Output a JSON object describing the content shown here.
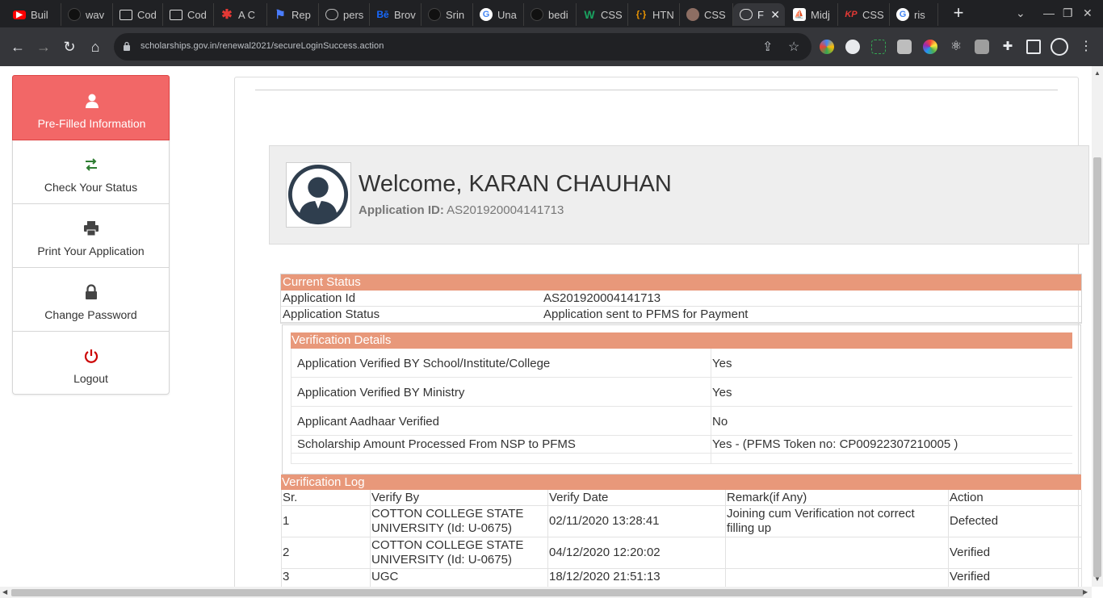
{
  "browser": {
    "tabs": [
      {
        "label": "Buil",
        "icon": "youtube-icon",
        "color": "#ff0000"
      },
      {
        "label": "wav",
        "icon": "github-icon",
        "color": "#202124"
      },
      {
        "label": "Cod",
        "icon": "codepen-icon",
        "color": "#202124"
      },
      {
        "label": "Cod",
        "icon": "codepen-icon",
        "color": "#202124"
      },
      {
        "label": "A C",
        "icon": "asterisk-icon",
        "color": "#e53935"
      },
      {
        "label": "Rep",
        "icon": "flag-icon",
        "color": "#4a7dff"
      },
      {
        "label": "pers",
        "icon": "globe-icon",
        "color": "#9aa0a6"
      },
      {
        "label": "Brov",
        "icon": "behance-icon",
        "color": "#1769ff"
      },
      {
        "label": "Srin",
        "icon": "github-icon",
        "color": "#202124"
      },
      {
        "label": "Una",
        "icon": "google-icon",
        "color": "#ffffff"
      },
      {
        "label": "bedi",
        "icon": "github-icon",
        "color": "#202124"
      },
      {
        "label": "CSS",
        "icon": "w-icon",
        "color": "#1aa260"
      },
      {
        "label": "HTN",
        "icon": "code-braces-icon",
        "color": "#f29900"
      },
      {
        "label": "CSS",
        "icon": "monkey-icon",
        "color": "#8d6e63"
      },
      {
        "label": "F",
        "icon": "globe-icon",
        "color": "#9aa0a6",
        "active": true
      },
      {
        "label": "Midj",
        "icon": "sail-icon",
        "color": "#ffffff"
      },
      {
        "label": "CSS",
        "icon": "kp-icon",
        "color": "#e53935"
      },
      {
        "label": "ris",
        "icon": "google-icon",
        "color": "#ffffff"
      }
    ],
    "new_tab": "+",
    "url": "scholarships.gov.in/renewal2021/secureLoginSuccess.action"
  },
  "sidebar": {
    "items": [
      {
        "label": "Pre-Filled Information",
        "icon": "user-icon"
      },
      {
        "label": "Check Your Status",
        "icon": "transfer-arrows-icon"
      },
      {
        "label": "Print Your Application",
        "icon": "printer-icon"
      },
      {
        "label": "Change Password",
        "icon": "lock-icon"
      },
      {
        "label": "Logout",
        "icon": "power-icon"
      }
    ]
  },
  "welcome": {
    "title": "Welcome, KARAN CHAUHAN",
    "app_id_label": "Application ID:",
    "app_id_value": "AS201920004141713"
  },
  "current_status": {
    "header": "Current Status",
    "rows": [
      {
        "label": "Application Id",
        "value": "AS201920004141713"
      },
      {
        "label": "Application Status",
        "value": "Application sent to PFMS for Payment"
      }
    ]
  },
  "verification_details": {
    "header": "Verification Details",
    "rows": [
      {
        "label": "Application Verified BY School/Institute/College",
        "value": "Yes"
      },
      {
        "label": "Application Verified BY Ministry",
        "value": "Yes"
      },
      {
        "label": "Applicant Aadhaar Verified",
        "value": "No"
      },
      {
        "label": "Scholarship Amount Processed From NSP to PFMS",
        "value": "Yes - (PFMS Token no: CP00922307210005 )"
      }
    ]
  },
  "verification_log": {
    "header": "Verification Log",
    "columns": [
      "Sr.",
      "Verify By",
      "Verify Date",
      "Remark(if Any)",
      "Action"
    ],
    "rows": [
      {
        "sr": "1",
        "by": "COTTON COLLEGE STATE UNIVERSITY (Id: U-0675)",
        "date": "02/11/2020 13:28:41",
        "remark": "Joining cum Verification not correct filling up",
        "action": "Defected"
      },
      {
        "sr": "2",
        "by": "COTTON COLLEGE STATE UNIVERSITY (Id: U-0675)",
        "date": "04/12/2020 12:20:02",
        "remark": "",
        "action": "Verified"
      },
      {
        "sr": "3",
        "by": "UGC",
        "date": "18/12/2020 21:51:13",
        "remark": "",
        "action": "Verified"
      }
    ]
  },
  "colors": {
    "sidebar_active": "#f26767",
    "table_header": "#e8987a",
    "logout_icon": "#cc0000",
    "status_icon": "#2e7d32"
  }
}
